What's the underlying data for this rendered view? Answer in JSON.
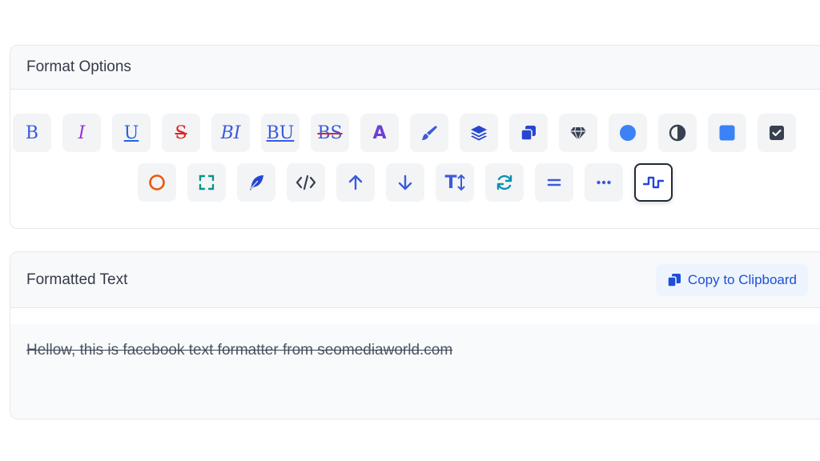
{
  "format_options": {
    "title": "Format Options",
    "row1": [
      {
        "name": "bold-button",
        "label": "B",
        "color": "#3b5bdb"
      },
      {
        "name": "italic-button",
        "label": "I",
        "color": "#9b30d9"
      },
      {
        "name": "underline-button",
        "label": "U",
        "color": "#2563eb"
      },
      {
        "name": "strikethrough-button",
        "label": "S",
        "color": "#dc2626"
      },
      {
        "name": "bold-italic-button",
        "label": "BI",
        "color": "#3b5bdb"
      },
      {
        "name": "bold-underline-button",
        "label": "BU",
        "color": "#3b5bdb"
      },
      {
        "name": "bold-strikethrough-button",
        "label": "BS",
        "color": "#3b5bdb"
      },
      {
        "name": "font-style-button",
        "label": "A",
        "color": "#6d3fd8"
      }
    ],
    "icon_colors": {
      "brush": "#3b5bdb",
      "layers": "#2547d0",
      "copy": "#2547d0",
      "diamond": "#374151",
      "circle": "#3b82f6",
      "contrast": "#374151",
      "square": "#3b82f6",
      "checkbox": "#374151",
      "ring": "#ea580c",
      "frame": "#0d9488",
      "feather": "#2547d0",
      "code": "#374151",
      "arrow_up": "#3b5bdb",
      "arrow_down": "#3b5bdb",
      "text_height": "#3b5bdb",
      "refresh": "#0891b2",
      "equals": "#3b5bdb",
      "dots": "#3b5bdb",
      "wave": "#2547d0"
    },
    "text_height_label": "T"
  },
  "formatted_text": {
    "title": "Formatted Text",
    "copy_label": "Copy to Clipboard",
    "content": "Hellow, this is facebook text formatter from seomediaworld.com"
  }
}
